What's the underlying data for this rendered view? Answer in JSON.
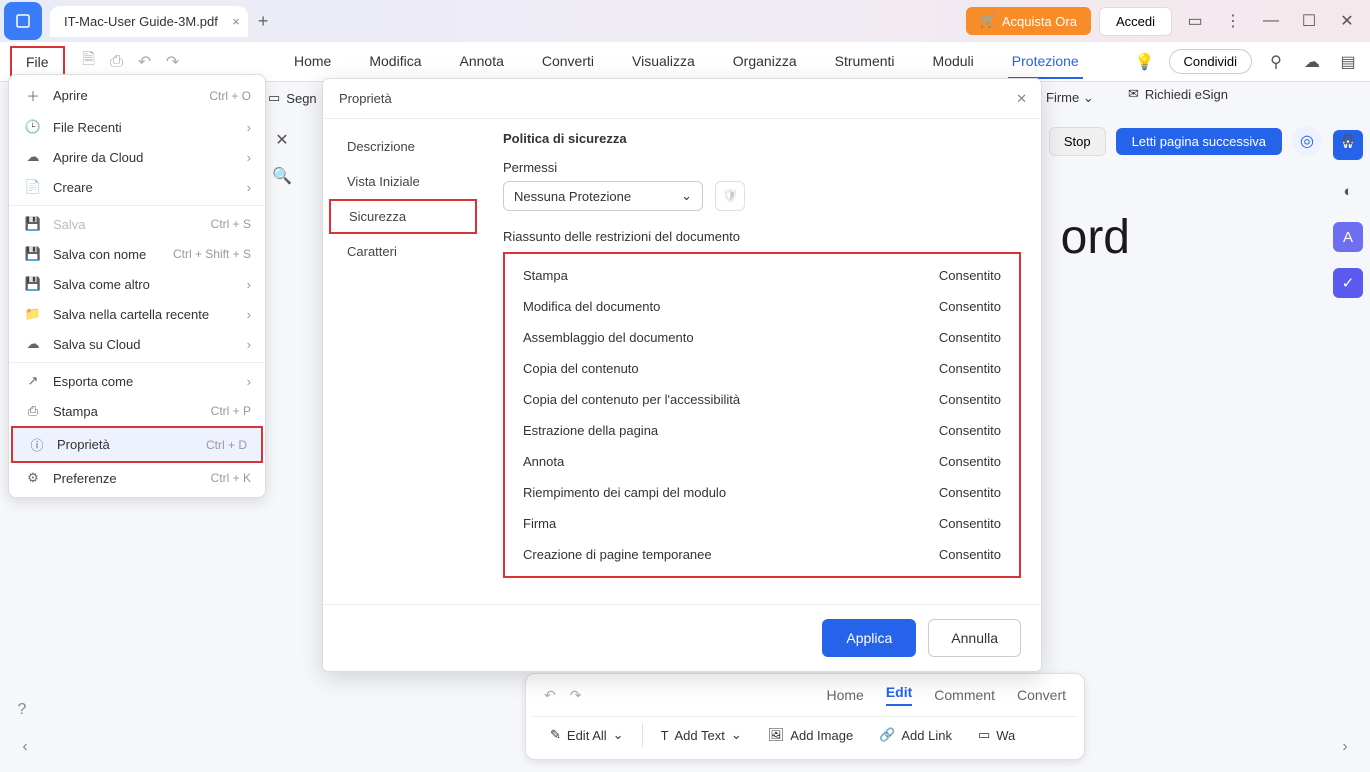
{
  "titlebar": {
    "tab_title": "IT-Mac-User Guide-3M.pdf",
    "buy": "Acquista Ora",
    "login": "Accedi"
  },
  "toolbar": {
    "file": "File",
    "tabs": [
      "Home",
      "Modifica",
      "Annota",
      "Converti",
      "Visualizza",
      "Organizza",
      "Strumenti",
      "Moduli",
      "Protezione"
    ],
    "active_tab": "Protezione",
    "share": "Condividi"
  },
  "secondary": {
    "segn": "Segn",
    "firme": "Firme",
    "esign": "Richiedi eSign",
    "stop": "Stop",
    "read_next": "Letti pagina successiva"
  },
  "file_menu": {
    "items": [
      {
        "label": "Aprire",
        "shortcut": "Ctrl + O",
        "icon": "plus"
      },
      {
        "label": "File Recenti",
        "chev": true,
        "icon": "clock"
      },
      {
        "label": "Aprire da Cloud",
        "chev": true,
        "icon": "cloud"
      },
      {
        "label": "Creare",
        "chev": true,
        "icon": "file-plus"
      },
      {
        "label": "Salva",
        "shortcut": "Ctrl + S",
        "disabled": true,
        "icon": "save"
      },
      {
        "label": "Salva con nome",
        "shortcut": "Ctrl + Shift + S",
        "icon": "save-as"
      },
      {
        "label": "Salva come altro",
        "chev": true,
        "icon": "save-other"
      },
      {
        "label": "Salva nella cartella recente",
        "chev": true,
        "icon": "folder"
      },
      {
        "label": "Salva su Cloud",
        "chev": true,
        "icon": "cloud-up"
      },
      {
        "label": "Esporta come",
        "chev": true,
        "icon": "export"
      },
      {
        "label": "Stampa",
        "shortcut": "Ctrl + P",
        "icon": "print"
      },
      {
        "label": "Proprietà",
        "shortcut": "Ctrl + D",
        "icon": "info",
        "selected": true
      },
      {
        "label": "Preferenze",
        "shortcut": "Ctrl + K",
        "icon": "settings"
      }
    ]
  },
  "dialog": {
    "title": "Proprietà",
    "sidebar": [
      "Descrizione",
      "Vista Iniziale",
      "Sicurezza",
      "Caratteri"
    ],
    "active_side": "Sicurezza",
    "content": {
      "heading": "Politica di sicurezza",
      "perm_label": "Permessi",
      "perm_value": "Nessuna Protezione",
      "restrict_label": "Riassunto delle restrizioni del documento",
      "rows": [
        {
          "k": "Stampa",
          "v": "Consentito"
        },
        {
          "k": "Modifica del documento",
          "v": "Consentito"
        },
        {
          "k": "Assemblaggio del documento",
          "v": "Consentito"
        },
        {
          "k": "Copia del contenuto",
          "v": "Consentito"
        },
        {
          "k": "Copia del contenuto per l'accessibilità",
          "v": "Consentito"
        },
        {
          "k": "Estrazione della pagina",
          "v": "Consentito"
        },
        {
          "k": "Annota",
          "v": "Consentito"
        },
        {
          "k": "Riempimento dei campi del modulo",
          "v": "Consentito"
        },
        {
          "k": "Firma",
          "v": "Consentito"
        },
        {
          "k": "Creazione di pagine temporanee",
          "v": "Consentito"
        }
      ]
    },
    "apply": "Applica",
    "cancel": "Annulla"
  },
  "doc_bg": "ord",
  "bottom": {
    "tabs": [
      "Home",
      "Edit",
      "Comment",
      "Convert"
    ],
    "active": "Edit",
    "actions": [
      "Edit All",
      "Add Text",
      "Add Image",
      "Add Link",
      "Wa"
    ]
  }
}
